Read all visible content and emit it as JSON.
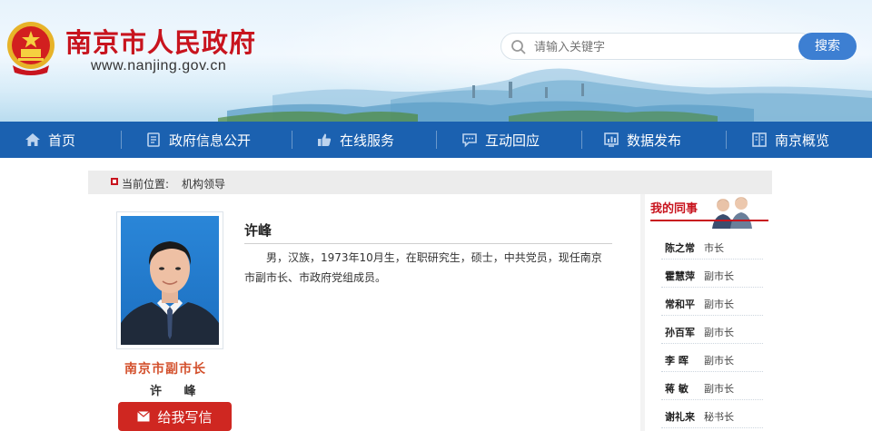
{
  "header": {
    "site_title": "南京市人民政府",
    "site_url": "www.nanjing.gov.cn",
    "search_placeholder": "请输入关键字",
    "search_button": "搜索"
  },
  "nav": {
    "items": [
      {
        "label": "首页",
        "icon": "home-icon"
      },
      {
        "label": "政府信息公开",
        "icon": "document-icon"
      },
      {
        "label": "在线服务",
        "icon": "thumbs-up-icon"
      },
      {
        "label": "互动回应",
        "icon": "chat-icon"
      },
      {
        "label": "数据发布",
        "icon": "chart-icon"
      },
      {
        "label": "南京概览",
        "icon": "book-icon"
      }
    ]
  },
  "breadcrumb": {
    "prefix": "当前位置:",
    "current": "机构领导"
  },
  "profile": {
    "title": "南京市副市长",
    "name_caption": "许  峰",
    "name": "许峰",
    "bio": "男，汉族，1973年10月生，在职研究生，硕士，中共党员，现任南京市副市长、市政府党组成员。",
    "write_button": "给我写信"
  },
  "colleagues": {
    "heading": "我的同事",
    "items": [
      {
        "name": "陈之常",
        "position": "市长"
      },
      {
        "name": "霍慧萍",
        "position": "副市长"
      },
      {
        "name": "常和平",
        "position": "副市长"
      },
      {
        "name": "孙百军",
        "position": "副市长"
      },
      {
        "name": "李  晖",
        "position": "副市长"
      },
      {
        "name": "蒋  敏",
        "position": "副市长"
      },
      {
        "name": "谢礼来",
        "position": "秘书长"
      }
    ]
  },
  "colors": {
    "brand_red": "#c8141e",
    "nav_blue": "#1b61b0",
    "search_button_blue": "#3d7fd2"
  }
}
